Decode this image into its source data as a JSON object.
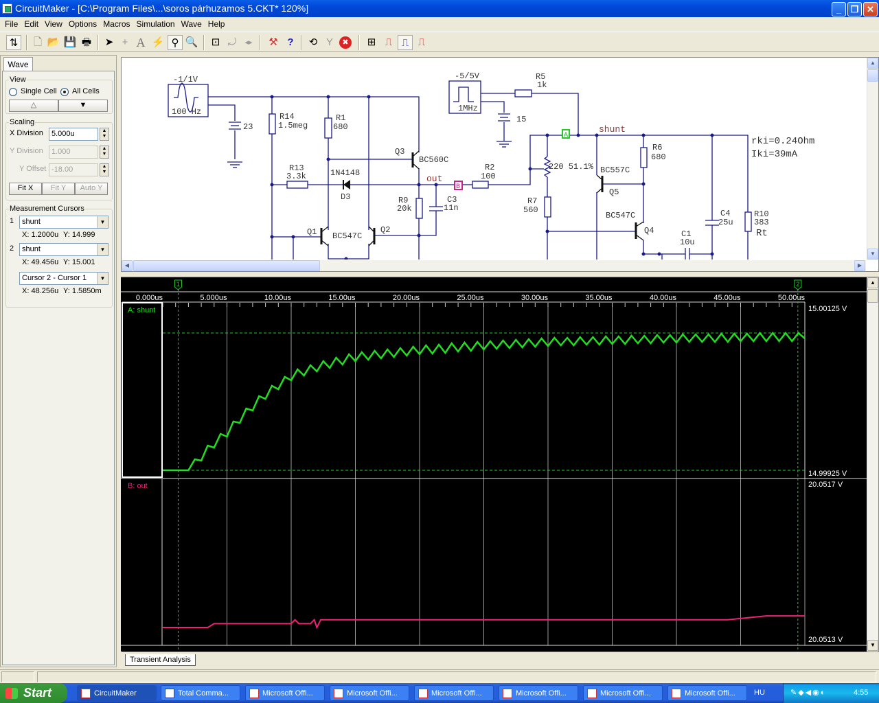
{
  "window": {
    "title": "CircuitMaker - [C:\\Program Files\\...\\soros párhuzamos 5.CKT* 120%]",
    "controls": {
      "minimize": "_",
      "maximize": "❐",
      "close": "✕"
    }
  },
  "menu": [
    "File",
    "Edit",
    "View",
    "Options",
    "Macros",
    "Simulation",
    "Wave",
    "Help"
  ],
  "toolbar": {
    "icons": [
      "schematic-wave-toggle-icon",
      "new-file-icon",
      "open-folder-icon",
      "save-icon",
      "print-icon",
      "arrow-select-icon",
      "wire-cross-icon",
      "text-icon",
      "probe-lightning-icon",
      "probe-tool-icon",
      "zoom-icon",
      "zoom-fit-icon",
      "rotate-icon",
      "mirror-icon",
      "netlist-icon",
      "help-icon",
      "reset-icon",
      "step-icon",
      "stop-icon",
      "device-icon",
      "digital-wave-icon",
      "analog-wave-icon",
      "mixed-wave-icon"
    ],
    "glyphs": [
      "⇅",
      "🗋",
      "📂",
      "💾",
      "🖶",
      "➤",
      "+",
      "A",
      "⚡",
      "⚲",
      "🔍",
      "⊡",
      "⤾",
      "◂▸",
      "⚒",
      "?",
      "⟲",
      "Y",
      "✖",
      "⊞",
      "⎍",
      "⎍",
      "⎍"
    ]
  },
  "panel": {
    "tab": "Wave",
    "view": {
      "title": "View",
      "single": "Single Cell",
      "all": "All Cells",
      "selected": "All Cells",
      "up": "△",
      "down": "▼"
    },
    "scaling": {
      "title": "Scaling",
      "x_label": "X Division",
      "x_value": "5.000u",
      "y_label": "Y Division",
      "y_value": "1.000",
      "offset_label": "Y Offset",
      "offset_value": "-18.00",
      "fit_x": "Fit X",
      "fit_y": "Fit Y",
      "auto_y": "Auto Y"
    },
    "cursors": {
      "title": "Measurement Cursors",
      "c1": {
        "num": "1",
        "trace": "shunt",
        "x": "X: 1.2000u",
        "y": "Y: 14.999"
      },
      "c2": {
        "num": "2",
        "trace": "shunt",
        "x": "X: 49.456u",
        "y": "Y: 15.001"
      },
      "diff": {
        "mode": "Cursor 2 - Cursor 1",
        "x": "X: 48.256u",
        "y": "Y: 1.5850m"
      }
    }
  },
  "schematic": {
    "sine_amp": "-1/1V",
    "sine_freq": "100 Hz",
    "bat1": "23",
    "R14": "R14",
    "R14v": "1.5meg",
    "R1": "R1",
    "R1v": "680",
    "R13": "R13",
    "R13v": "3.3k",
    "D3type": "1N4148",
    "D3": "D3",
    "Q3": "Q3",
    "Q3type": "BC560C",
    "out": "out",
    "B": "B",
    "R9": "R9",
    "R9v": "20k",
    "C3": "C3",
    "C3v": "11n",
    "Q1": "Q1",
    "Q12type": "BC547C",
    "Q2": "Q2",
    "pulse_amp": "-5/5V",
    "pulse_freq": "1MHz",
    "bat2": "15",
    "R5": "R5",
    "R5v": "1k",
    "A": "A",
    "shunt": "shunt",
    "R2": "R2",
    "R2v": "100",
    "pot": "220  51.1%",
    "R7": "R7",
    "R7v": "560",
    "Q5type": "BC557C",
    "Q5": "Q5",
    "R6": "R6",
    "R6v": "680",
    "Q4type": "BC547C",
    "Q4": "Q4",
    "C1": "C1",
    "C1v": "10u",
    "C4": "C4",
    "C4v": "25u",
    "R10": "R10",
    "R10v": "383",
    "Rt": "Rt",
    "note1": "rki=0.24Ohm",
    "note2": "Iki=39mA",
    "wire_color": "#1a1a8c",
    "marker_a_color": "#22cc22",
    "marker_b_color": "#cc2288",
    "net_label_color": "#a03030"
  },
  "chart_data": {
    "type": "line",
    "xlabel": "",
    "xlim": [
      0,
      50
    ],
    "x_ticks": [
      0,
      5,
      10,
      15,
      20,
      25,
      30,
      35,
      40,
      45,
      50
    ],
    "x_tick_labels": [
      "0.000us",
      "5.000us",
      "10.00us",
      "15.00us",
      "20.00us",
      "25.00us",
      "30.00us",
      "35.00us",
      "40.00us",
      "45.00us",
      "50.00us"
    ],
    "grid": true,
    "cursors": [
      {
        "label": "1",
        "x": 1.2,
        "y": 14.999
      },
      {
        "label": "2",
        "x": 49.456,
        "y": 15.001
      }
    ],
    "panels": [
      {
        "name": "A: shunt",
        "color": "#22dd22",
        "y_top_label": "15.00125 V",
        "y_bottom_label": "14.99925 V",
        "points": [
          [
            0,
            14.999
          ],
          [
            2,
            14.999
          ],
          [
            2.5,
            14.99916
          ],
          [
            3,
            14.99914
          ],
          [
            3.5,
            14.99936
          ],
          [
            4,
            14.99933
          ],
          [
            4.5,
            14.99953
          ],
          [
            5,
            14.99949
          ],
          [
            5.5,
            14.99971
          ],
          [
            6,
            14.99969
          ],
          [
            6.5,
            14.9999
          ],
          [
            7,
            14.99987
          ],
          [
            7.5,
            15.00008
          ],
          [
            8,
            15.00004
          ],
          [
            8.5,
            15.00023
          ],
          [
            9,
            15.00018
          ],
          [
            9.5,
            15.00036
          ],
          [
            10,
            15.00031
          ],
          [
            10.5,
            15.00047
          ],
          [
            11,
            15.00038
          ],
          [
            11.5,
            15.00053
          ],
          [
            12,
            15.00044
          ],
          [
            12.5,
            15.00059
          ],
          [
            13,
            15.00049
          ],
          [
            13.5,
            15.00064
          ],
          [
            14,
            15.00054
          ],
          [
            14.5,
            15.00069
          ],
          [
            15,
            15.00059
          ],
          [
            15.5,
            15.00072
          ],
          [
            16,
            15.00061
          ],
          [
            16.5,
            15.00074
          ],
          [
            17,
            15.00063
          ],
          [
            17.5,
            15.00076
          ],
          [
            18,
            15.00065
          ],
          [
            18.5,
            15.00078
          ],
          [
            19,
            15.00067
          ],
          [
            19.5,
            15.0008
          ],
          [
            20,
            15.00069
          ],
          [
            20.5,
            15.00082
          ],
          [
            21,
            15.0007
          ],
          [
            21.5,
            15.00083
          ],
          [
            22,
            15.00071
          ],
          [
            22.5,
            15.00085
          ],
          [
            23,
            15.00073
          ],
          [
            23.5,
            15.00086
          ],
          [
            24,
            15.00074
          ],
          [
            24.5,
            15.00087
          ],
          [
            25,
            15.00076
          ],
          [
            25.5,
            15.00088
          ],
          [
            26,
            15.00077
          ],
          [
            26.5,
            15.00089
          ],
          [
            27,
            15.00078
          ],
          [
            27.5,
            15.0009
          ],
          [
            28,
            15.00079
          ],
          [
            28.5,
            15.00091
          ],
          [
            29,
            15.0008
          ],
          [
            29.5,
            15.00092
          ],
          [
            30,
            15.00081
          ],
          [
            30.5,
            15.00093
          ],
          [
            31,
            15.00082
          ],
          [
            31.5,
            15.00093
          ],
          [
            32,
            15.00082
          ],
          [
            32.5,
            15.00094
          ],
          [
            33,
            15.00083
          ],
          [
            33.5,
            15.00094
          ],
          [
            34,
            15.00083
          ],
          [
            34.5,
            15.00095
          ],
          [
            35,
            15.00084
          ],
          [
            35.5,
            15.00095
          ],
          [
            36,
            15.00084
          ],
          [
            36.5,
            15.00096
          ],
          [
            37,
            15.00085
          ],
          [
            37.5,
            15.00096
          ],
          [
            38,
            15.00085
          ],
          [
            38.5,
            15.00097
          ],
          [
            39,
            15.00086
          ],
          [
            39.5,
            15.00097
          ],
          [
            40,
            15.00086
          ],
          [
            40.5,
            15.00098
          ],
          [
            41,
            15.00087
          ],
          [
            41.5,
            15.00098
          ],
          [
            42,
            15.00087
          ],
          [
            42.5,
            15.00098
          ],
          [
            43,
            15.00087
          ],
          [
            43.5,
            15.00099
          ],
          [
            44,
            15.00087
          ],
          [
            44.5,
            15.00099
          ],
          [
            45,
            15.00088
          ],
          [
            45.5,
            15.00099
          ],
          [
            46,
            15.00088
          ],
          [
            46.5,
            15.001
          ],
          [
            47,
            15.00088
          ],
          [
            47.5,
            15.001
          ],
          [
            48,
            15.00088
          ],
          [
            48.5,
            15.001
          ],
          [
            49,
            15.00088
          ],
          [
            49.5,
            15.001
          ],
          [
            50,
            15.00092
          ]
        ]
      },
      {
        "name": "B: out",
        "color": "#ee2277",
        "y_top_label": "20.0517 V",
        "y_bottom_label": "20.0513 V",
        "ylim": [
          20.0513,
          20.0517
        ],
        "points": [
          [
            0,
            20.05133
          ],
          [
            3.5,
            20.05133
          ],
          [
            4,
            20.05134
          ],
          [
            10,
            20.05134
          ],
          [
            10.3,
            20.05135
          ],
          [
            10.6,
            20.05134
          ],
          [
            11.5,
            20.05134
          ],
          [
            11.8,
            20.05135
          ],
          [
            12,
            20.05133
          ],
          [
            12.3,
            20.05135
          ],
          [
            20,
            20.05135
          ],
          [
            35,
            20.05135
          ],
          [
            44,
            20.05135
          ],
          [
            47,
            20.05136
          ],
          [
            50,
            20.05136
          ]
        ]
      }
    ]
  },
  "bottom_tab": "Transient Analysis",
  "taskbar": {
    "start": "Start",
    "items": [
      "CircuitMaker",
      "Total Comma...",
      "Microsoft Offi...",
      "Microsoft Offi...",
      "Microsoft Offi...",
      "Microsoft Offi...",
      "Microsoft Offi...",
      "Microsoft Offi..."
    ],
    "language": "HU",
    "clock": "4:55"
  }
}
